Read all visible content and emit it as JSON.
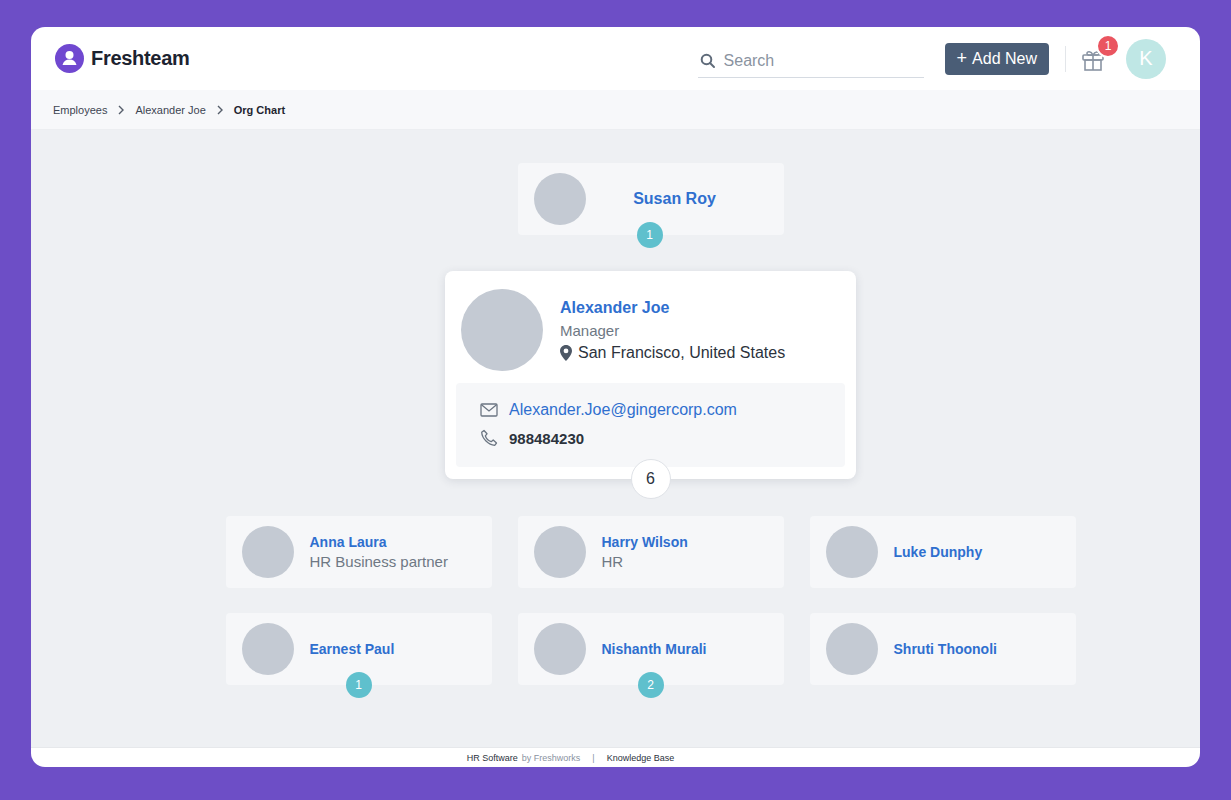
{
  "app": {
    "name": "Freshteam"
  },
  "search": {
    "placeholder": "Search"
  },
  "add_button": {
    "icon": "+",
    "label": "Add New"
  },
  "notifications": {
    "count": "1"
  },
  "user": {
    "initial": "K"
  },
  "breadcrumb": [
    {
      "label": "Employees",
      "current": false
    },
    {
      "label": "Alexander Joe",
      "current": false
    },
    {
      "label": "Org Chart",
      "current": true
    }
  ],
  "manager": {
    "name": "Susan Roy",
    "reports": "1"
  },
  "employee": {
    "name": "Alexander Joe",
    "title": "Manager",
    "location": "San Francisco, United States",
    "email": "Alexander.Joe@gingercorp.com",
    "phone": "988484230",
    "reports": "6"
  },
  "direct_reports": [
    {
      "name": "Anna Laura",
      "title": "HR Business partner"
    },
    {
      "name": "Harry Wilson",
      "title": "HR"
    },
    {
      "name": "Luke Dunphy"
    },
    {
      "name": "Earnest Paul",
      "reports": "1"
    },
    {
      "name": "Nishanth Murali",
      "reports": "2"
    },
    {
      "name": "Shruti Thoonoli"
    }
  ],
  "footer": {
    "product": "HR Software",
    "by": "by Freshworks",
    "separator": "|",
    "link": "Knowledge Base"
  }
}
